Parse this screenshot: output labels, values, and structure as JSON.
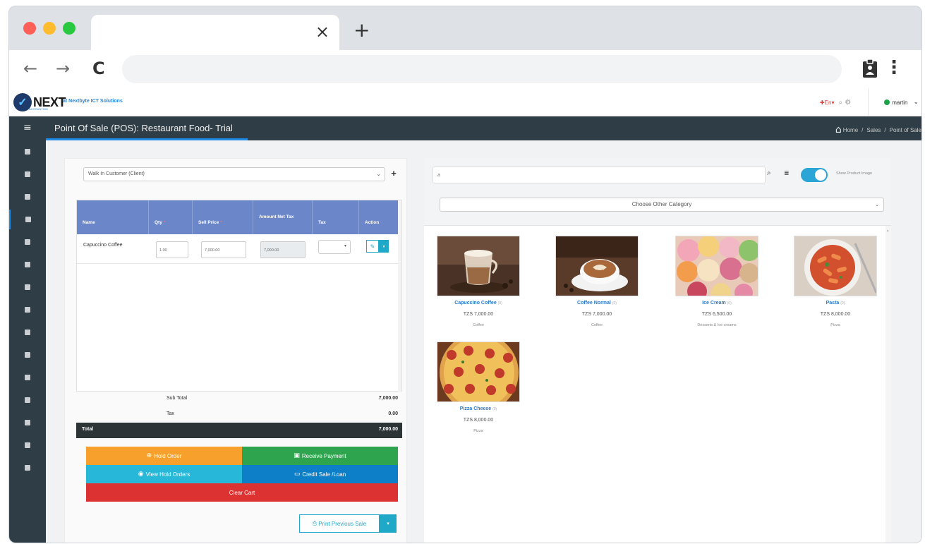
{
  "browser": {
    "tab_close": "×",
    "new_tab": "+",
    "back": "←",
    "forward": "→",
    "reload": "C",
    "menu": "⋮",
    "address": ""
  },
  "app": {
    "logo_text": "NEXT",
    "logo_sub": "ACCOUNTING",
    "company": "at Nextbyte ICT Solutions",
    "lang": "En",
    "user_name": "martin",
    "page_title": "Point Of Sale (POS): Restaurant Food- Trial",
    "breadcrumb": [
      "Home",
      "Sales",
      "Point of Sale"
    ]
  },
  "sidebar": {
    "icons": [
      "dashboard-icon",
      "chart-icon",
      "credit-card-icon",
      "pos-icon",
      "calculator-icon",
      "users-icon",
      "building-icon",
      "people-icon",
      "invoice-icon",
      "money-icon",
      "bell-icon",
      "file-icon",
      "cogs-icon",
      "id-card-icon",
      "list-icon"
    ]
  },
  "customer": {
    "value": "Walk In Customer (Client)",
    "add": "+"
  },
  "cart": {
    "headers": {
      "name": "Name",
      "qty": "Qty",
      "sell_price": "Sell Price",
      "amount_net_tax": "Amount Net Tax",
      "tax": "Tax",
      "action": "Action"
    },
    "rows": [
      {
        "name": "Capuccino Coffee",
        "qty": "1.00",
        "sell_price": "7,000.00",
        "amount": "7,000.00"
      }
    ]
  },
  "totals": {
    "subtotal_label": "Sub Total",
    "subtotal_value": "7,000.00",
    "tax_label": "Tax",
    "tax_value": "0.00",
    "total_label": "Total",
    "total_value": "7,000.00"
  },
  "actions": {
    "hold_order": "Hold Order",
    "receive_payment": "Receive Payment",
    "view_hold_orders": "View Hold Orders",
    "credit_sale": "Credit Sale /Loan",
    "clear_cart": "Clear Cart",
    "print_previous": "Print Previous Sale"
  },
  "search": {
    "value": "a",
    "show_image_label": "Show Product Image",
    "show_image_on": true,
    "category_placeholder": "Choose Other Category"
  },
  "products": [
    {
      "name": "Capuccino Coffee",
      "qty": "(0)",
      "price": "TZS 7,000.00",
      "category": "Coffee",
      "image": "cappuccino"
    },
    {
      "name": "Coffee Normal",
      "qty": "(0)",
      "price": "TZS 7,000.00",
      "category": "Coffee",
      "image": "latte"
    },
    {
      "name": "Ice Cream",
      "qty": "(0)",
      "price": "TZS 6,500.00",
      "category": "Desserts & Ice creams",
      "image": "icecream"
    },
    {
      "name": "Pasta",
      "qty": "(0)",
      "price": "TZS 8,000.00",
      "category": "Pizza",
      "image": "pasta"
    },
    {
      "name": "Pizza Cheese",
      "qty": "(0)",
      "price": "TZS 8,000.00",
      "category": "Pizza",
      "image": "pizza"
    }
  ],
  "colors": {
    "header_bar": "#2f3e46",
    "table_head": "#6b86c9",
    "hold_order": "#f7a12c",
    "receive_payment": "#2ea44f",
    "view_hold": "#27b7d9",
    "credit_sale": "#0d7fc9",
    "clear_cart": "#dc3232",
    "accent": "#20a8c8"
  }
}
